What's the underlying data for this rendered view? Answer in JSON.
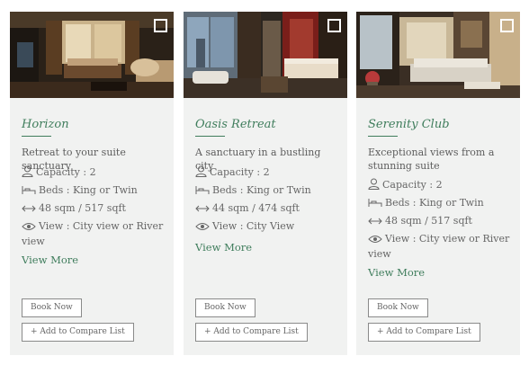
{
  "labels": {
    "capacity": "Capacity : 2",
    "beds": "Beds : King or Twin",
    "view_more": "View More",
    "book_now": "Book Now",
    "add_compare": "+ Add to Compare List"
  },
  "rooms": [
    {
      "name": "Horizon",
      "description": "Retreat to your suite sanctuary",
      "size": "48 sqm / 517 sqft",
      "view": "View : City view or River view"
    },
    {
      "name": "Oasis Retreat",
      "description": "A sanctuary in a bustling city",
      "size": "44 sqm / 474 sqft",
      "view": "View : City View"
    },
    {
      "name": "Serenity Club",
      "description": "Exceptional views from a stunning suite",
      "size": "48 sqm / 517 sqft",
      "view": "View : City view or River view"
    }
  ],
  "colors": {
    "accent": "#3f7d5c",
    "card_background": "#f1f2f1",
    "text": "#5d5d5d"
  },
  "icons": [
    "user-icon",
    "bed-icon",
    "double-arrow-icon",
    "eye-icon"
  ]
}
